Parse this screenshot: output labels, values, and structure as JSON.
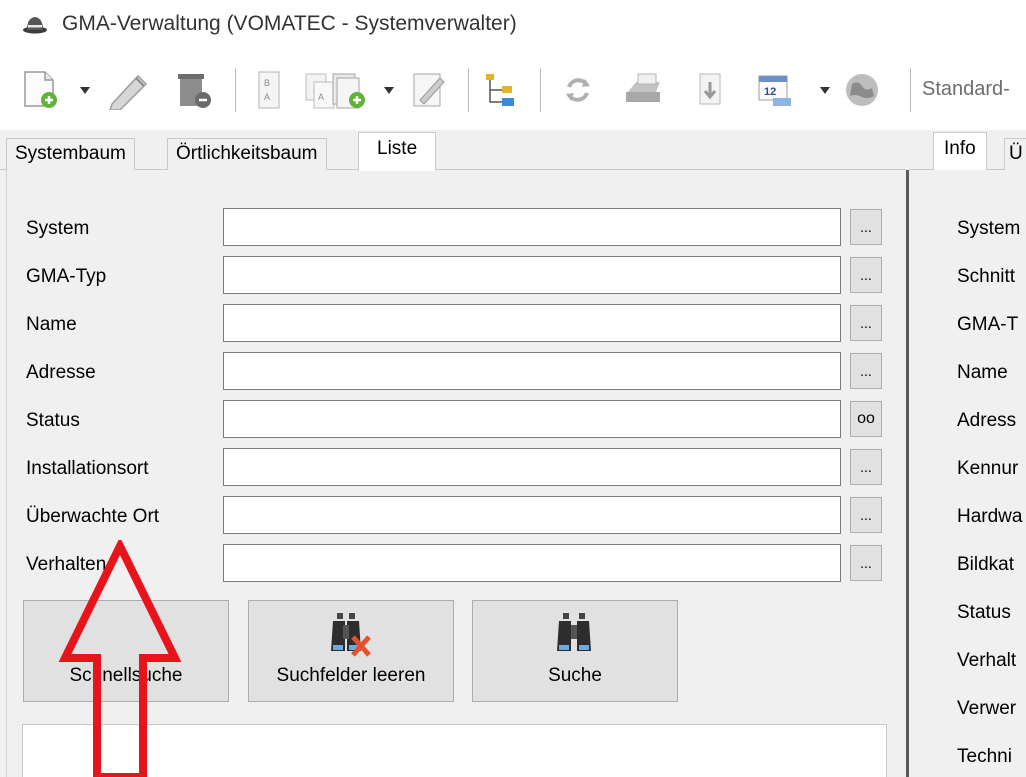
{
  "window": {
    "title": "GMA-Verwaltung (VOMATEC -  Systemverwalter)",
    "icon": "hat-icon"
  },
  "toolbar": {
    "items": [
      {
        "name": "new-document-icon",
        "has_dropdown": true
      },
      {
        "name": "edit-pencil-icon"
      },
      {
        "name": "delete-icon"
      },
      {
        "name": "sort-icon"
      },
      {
        "name": "copy-icon"
      },
      {
        "name": "add-page-icon",
        "has_dropdown": true
      },
      {
        "name": "edit-page-icon"
      },
      {
        "name": "tree-structure-icon"
      },
      {
        "name": "refresh-icon"
      },
      {
        "name": "print-icon"
      },
      {
        "name": "export-icon"
      },
      {
        "name": "calendar-icon",
        "has_dropdown": true,
        "text": "12"
      },
      {
        "name": "globe-icon"
      }
    ],
    "standard_label": "Standard-"
  },
  "left_tabs": [
    {
      "label": "Systembaum",
      "active": false
    },
    {
      "label": "Örtlichkeitsbaum",
      "active": false
    },
    {
      "label": "Liste",
      "active": true
    }
  ],
  "search_form": {
    "fields": [
      {
        "label": "System",
        "value": "",
        "button": "..."
      },
      {
        "label": "GMA-Typ",
        "value": "",
        "button": "..."
      },
      {
        "label": "Name",
        "value": "",
        "button": "..."
      },
      {
        "label": "Adresse",
        "value": "",
        "button": "..."
      },
      {
        "label": "Status",
        "value": "",
        "button": "oo"
      },
      {
        "label": "Installationsort",
        "value": "",
        "button": "..."
      },
      {
        "label": "Überwachte Ort",
        "value": "",
        "button": "..."
      },
      {
        "label": "Verhalten",
        "value": "",
        "button": "..."
      }
    ],
    "buttons": {
      "schnellsuche": "Schnellsuche",
      "clear": "Suchfelder leeren",
      "search": "Suche"
    }
  },
  "right_tabs": [
    {
      "label": "Info",
      "active": true
    },
    {
      "label": "Ü",
      "active": false
    }
  ],
  "info_labels": [
    "System",
    "Schnitt",
    "GMA-T",
    "Name",
    "Adress",
    "Kennur",
    "Hardwa",
    "Bildkat",
    "Status",
    "Verhalt",
    "Verwer",
    "Techni"
  ],
  "colors": {
    "arrow": "#e8141b",
    "splitter": "#5a5a5a",
    "button_face": "#e1e1e1"
  }
}
